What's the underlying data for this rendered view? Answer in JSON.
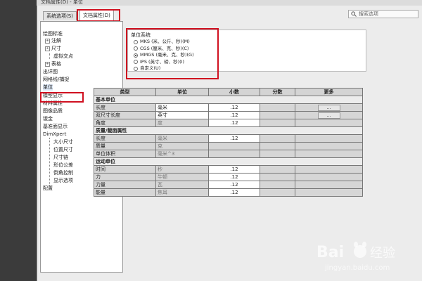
{
  "window": {
    "title": "文档属性(D) - 单位"
  },
  "tabs": [
    {
      "label": "系统选项(S)"
    },
    {
      "label": "文档属性(D)"
    }
  ],
  "search": {
    "placeholder": "搜索选项"
  },
  "tree": {
    "items": [
      {
        "label": "绘图标准",
        "level": 0
      },
      {
        "label": "注解",
        "level": 1,
        "expander": "+"
      },
      {
        "label": "尺寸",
        "level": 1,
        "expander": "+"
      },
      {
        "label": "虚拟交点",
        "level": 2
      },
      {
        "label": "表格",
        "level": 1,
        "expander": "+"
      },
      {
        "label": "出详图",
        "level": 0
      },
      {
        "label": "网格线/捕捉",
        "level": 0
      },
      {
        "label": "单位",
        "level": 0,
        "selected": true
      },
      {
        "label": "模型显示",
        "level": 0
      },
      {
        "label": "材料属性",
        "level": 0
      },
      {
        "label": "图像品质",
        "level": 0
      },
      {
        "label": "钣金",
        "level": 0
      },
      {
        "label": "基准面显示",
        "level": 0
      },
      {
        "label": "DimXpert",
        "level": 0
      },
      {
        "label": "大小尺寸",
        "level": 2
      },
      {
        "label": "位置尺寸",
        "level": 2
      },
      {
        "label": "尺寸链",
        "level": 2
      },
      {
        "label": "形位公差",
        "level": 2
      },
      {
        "label": "倒角控制",
        "level": 2
      },
      {
        "label": "显示选项",
        "level": 2
      },
      {
        "label": "配置",
        "level": 0
      }
    ]
  },
  "unit_system": {
    "title": "单位系统",
    "options": [
      {
        "label": "MKS (米、公斤、秒)(M)",
        "checked": false
      },
      {
        "label": "CGS (厘米、克、秒)(C)",
        "checked": false
      },
      {
        "label": "MMGS (毫米、克、秒)(G)",
        "checked": true
      },
      {
        "label": "IPS (英寸、磅、秒)(I)",
        "checked": false
      },
      {
        "label": "自定义(U)",
        "checked": false
      }
    ]
  },
  "table": {
    "headers": [
      "类型",
      "单位",
      "小数",
      "分数",
      "更多"
    ],
    "groups": [
      {
        "name": "基本单位",
        "rows": [
          {
            "type": "长度",
            "unit": "毫米",
            "decimals": ".12",
            "more": "..."
          },
          {
            "type": "双尺寸长度",
            "unit": "英寸",
            "decimals": ".12",
            "more": "..."
          },
          {
            "type": "角度",
            "unit": "度",
            "decimals": ".12",
            "more": ""
          }
        ]
      },
      {
        "name": "质量/截面属性",
        "rows": [
          {
            "type": "长度",
            "unit": "毫米",
            "decimals": ".12",
            "more": ""
          },
          {
            "type": "质量",
            "unit": "克",
            "decimals": "",
            "more": ""
          },
          {
            "type": "单位体积",
            "unit": "毫米^3",
            "decimals": "",
            "more": ""
          }
        ]
      },
      {
        "name": "运动单位",
        "rows": [
          {
            "type": "时间",
            "unit": "秒",
            "decimals": ".12",
            "more": ""
          },
          {
            "type": "力",
            "unit": "牛顿",
            "decimals": ".12",
            "more": ""
          },
          {
            "type": "力量",
            "unit": "瓦",
            "decimals": ".12",
            "more": ""
          },
          {
            "type": "能量",
            "unit": "焦耳",
            "decimals": ".12",
            "more": ""
          }
        ]
      }
    ]
  },
  "watermark": {
    "brand": "Bai",
    "brand2": "经验",
    "url": "jingyan.baidu.com"
  },
  "colors": {
    "highlight_box": "#d01020",
    "selection": "#dde8f6"
  }
}
